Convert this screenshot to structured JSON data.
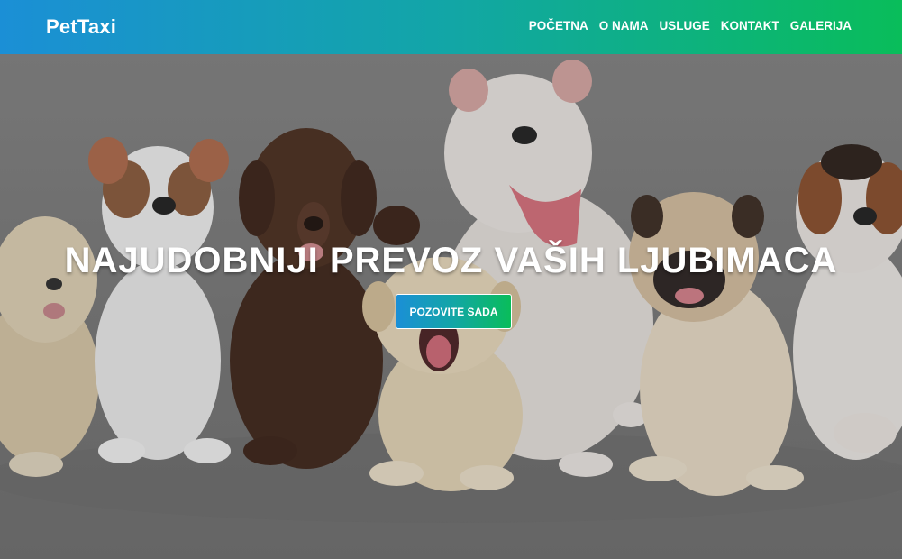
{
  "header": {
    "logo": "PetTaxi",
    "nav": [
      {
        "label": "POČETNA"
      },
      {
        "label": "O NAMA"
      },
      {
        "label": "USLUGE"
      },
      {
        "label": "KONTAKT"
      },
      {
        "label": "GALERIJA"
      }
    ]
  },
  "hero": {
    "title": "NAJUDOBNIJI PREVOZ VAŠIH LJUBIMACA",
    "cta_label": "POZOVITE SADA",
    "image_subject": "group of puppies"
  },
  "colors": {
    "gradient_start": "#1b8fd6",
    "gradient_mid": "#12a6a6",
    "gradient_end": "#09bd5a",
    "text": "#ffffff"
  }
}
